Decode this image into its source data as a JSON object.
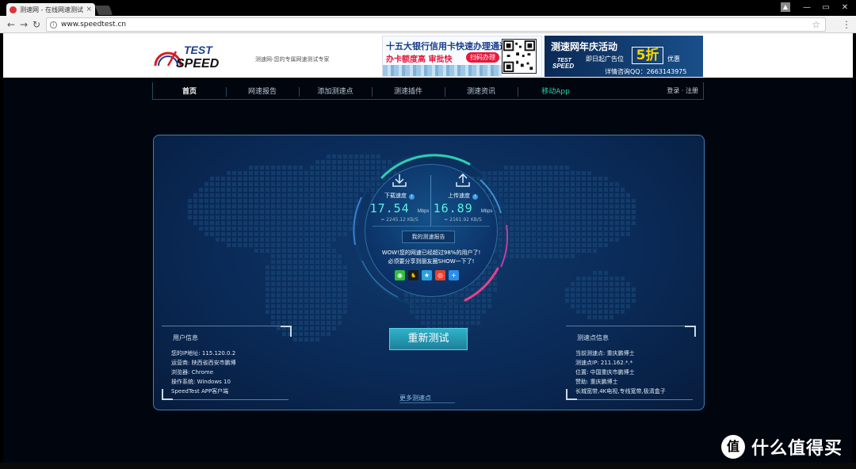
{
  "browser": {
    "tab_title": "测速网 - 在线网速测试,网",
    "tab_close": "×",
    "url": "www.speedtest.cn",
    "profile_label": "▲",
    "win_min": "—",
    "win_max": "▭",
    "win_close": "✕",
    "back": "←",
    "forward": "→",
    "reload": "↻",
    "star": "☆",
    "menu": "⋮"
  },
  "header": {
    "logo_top": "TEST",
    "logo_bottom": "SPEED",
    "slogan": "测速网-您的专属网速测试专家",
    "ad1": {
      "title": "十五大银行信用卡快速办理通道",
      "subtitle": "办卡额度高 审批快",
      "button": "扫码办理"
    },
    "ad2": {
      "title": "测速网年庆活动",
      "subtitle": "即日起广告位",
      "discount": "5折",
      "discount_suffix": "优惠",
      "contact": "详情咨询QQ：2663143975"
    }
  },
  "nav": {
    "items": [
      {
        "label": "首页"
      },
      {
        "label": "网速报告"
      },
      {
        "label": "添加测速点"
      },
      {
        "label": "测速插件"
      },
      {
        "label": "测速资讯"
      },
      {
        "label": "移动App"
      }
    ],
    "login": "登录 · 注册"
  },
  "result": {
    "download": {
      "label": "下载速度",
      "value": "17.54",
      "unit": "Mbps",
      "kbs": "= 2245.12 KB/S"
    },
    "upload": {
      "label": "上传速度",
      "value": "16.89",
      "unit": "Mbps",
      "kbs": "= 2161.92 KB/S"
    },
    "report_button": "我的测速报告",
    "wow_line1": "WOW!您的网速已经超过98%的用户了!",
    "wow_line2": "必须要分享到朋友圈SHOW一下了!",
    "share_icons": [
      "wechat-icon",
      "qq-icon",
      "qzone-icon",
      "weibo-icon",
      "more-share-icon"
    ],
    "retest_button": "重新测试",
    "more_points": "更多测速点"
  },
  "user_info": {
    "title": "用户信息",
    "rows": [
      "您的IP地址:  115.120.0.2",
      "运营商:  陕西省西安市鹏博",
      "浏览器:  Chrome",
      "操作系统:  Windows 10",
      "SpeedTest APP客户端"
    ]
  },
  "server_info": {
    "title": "测速点信息",
    "rows": [
      "当前测速点:  重庆鹏博士",
      "测速点IP:  211.162.*.*",
      "位置:  中国重庆市鹏博士",
      "赞助:  重庆鹏博士",
      "长城宽带,4K电视,专线宽带,极清盒子"
    ]
  },
  "watermark": {
    "logo": "值",
    "text": "什么值得买"
  },
  "colors": {
    "accent": "#5cf0e1",
    "panel_border": "#3f7fb6",
    "app_link": "#27d1b0"
  }
}
